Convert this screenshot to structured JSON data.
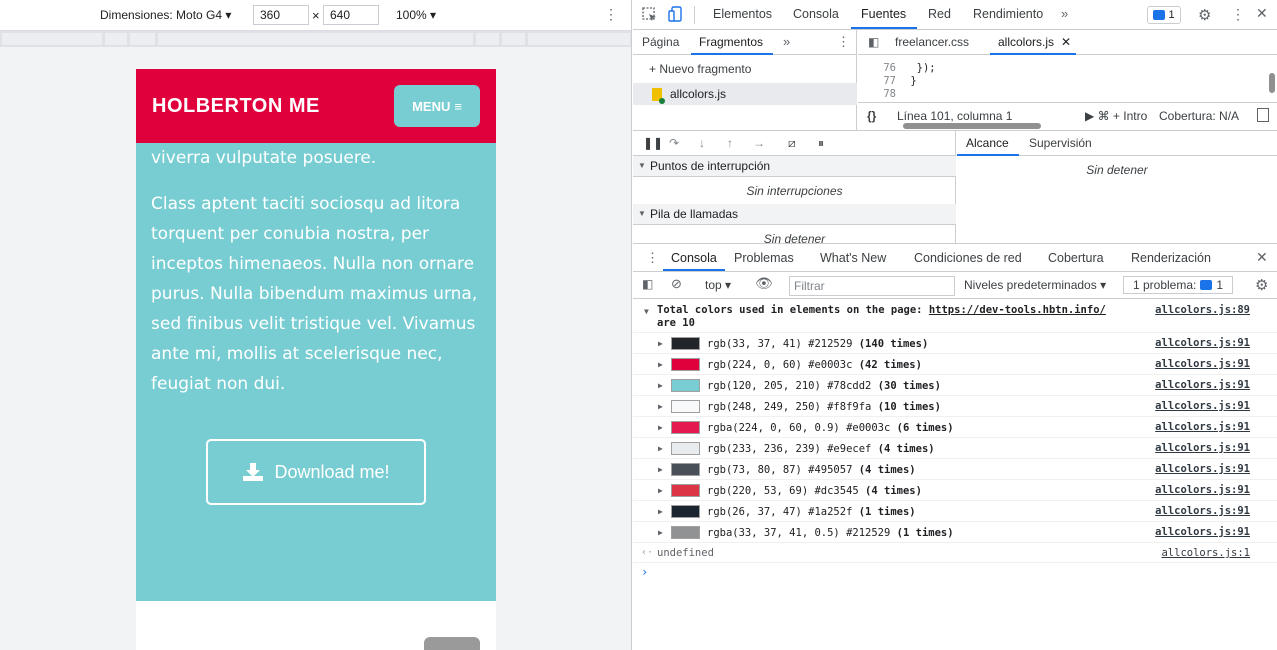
{
  "device_toolbar": {
    "dimensions_label": "Dimensiones: Moto G4",
    "width": "360",
    "times": "×",
    "height": "640",
    "zoom": "100%"
  },
  "site": {
    "brand": "HOLBERTON ME",
    "menu_label": "MENU",
    "para1": "viverra vulputate posuere.",
    "para2": "Class aptent taciti sociosqu ad litora torquent per conubia nostra, per inceptos himenaeos. Nulla non ornare purus. Nulla bibendum maximus urna, sed finibus velit tristique vel. Vivamus ante mi, mollis at scelerisque nec, feugiat non dui.",
    "download_label": "Download me!",
    "colors": {
      "brand_red": "#e0003c",
      "teal": "#78cdd2"
    }
  },
  "devtools": {
    "tabs": [
      "Elementos",
      "Consola",
      "Fuentes",
      "Red",
      "Rendimiento"
    ],
    "active_tab": "Fuentes",
    "issues_count": "1",
    "nav_tabs": [
      "Página",
      "Fragmentos"
    ],
    "new_snippet": "+ Nuevo fragmento",
    "snippet_file": "allcolors.js",
    "editor_tabs": [
      "freelancer.css",
      "allcolors.js"
    ],
    "code_lines": [
      {
        "num": "76",
        "text": "  });"
      },
      {
        "num": "77",
        "text": " }"
      },
      {
        "num": "78",
        "text": ""
      }
    ],
    "status": {
      "braces": "{}",
      "position": "Línea 101, columna 1",
      "run": "⌘ + Intro",
      "coverage": "Cobertura: N/A"
    },
    "debugger": {
      "breakpoints_title": "Puntos de interrupción",
      "breakpoints_empty": "Sin interrupciones",
      "callstack_title": "Pila de llamadas",
      "callstack_empty": "Sin detener",
      "scope_tab": "Alcance",
      "watch_tab": "Supervisión",
      "scope_empty": "Sin detener"
    },
    "drawer_tabs": [
      "Consola",
      "Problemas",
      "What's New",
      "Condiciones de red",
      "Cobertura",
      "Renderización"
    ],
    "console_toolbar": {
      "context": "top",
      "filter_placeholder": "Filtrar",
      "levels": "Niveles predeterminados",
      "problems": "1 problema:",
      "problems_count": "1"
    },
    "console": {
      "header_text": "Total colors used in elements on the page:",
      "header_link": "https://dev-tools.hbtn.info/",
      "header_text2": "are 10",
      "header_src": "allcolors.js:89",
      "rows": [
        {
          "color": "#212529",
          "label": "rgb(33, 37, 41) #212529",
          "times": "(140 times)",
          "src": "allcolors.js:91"
        },
        {
          "color": "#e0003c",
          "label": "rgb(224, 0, 60) #e0003c",
          "times": "(42 times)",
          "src": "allcolors.js:91"
        },
        {
          "color": "#78cdd2",
          "label": "rgb(120, 205, 210) #78cdd2",
          "times": "(30 times)",
          "src": "allcolors.js:91"
        },
        {
          "color": "#f8f9fa",
          "label": "rgb(248, 249, 250) #f8f9fa",
          "times": "(10 times)",
          "src": "allcolors.js:91"
        },
        {
          "color": "rgba(224,0,60,0.9)",
          "label": "rgba(224, 0, 60, 0.9) #e0003c",
          "times": "(6 times)",
          "src": "allcolors.js:91"
        },
        {
          "color": "#e9ecef",
          "label": "rgb(233, 236, 239) #e9ecef",
          "times": "(4 times)",
          "src": "allcolors.js:91"
        },
        {
          "color": "#495057",
          "label": "rgb(73, 80, 87) #495057",
          "times": "(4 times)",
          "src": "allcolors.js:91"
        },
        {
          "color": "#dc3545",
          "label": "rgb(220, 53, 69) #dc3545",
          "times": "(4 times)",
          "src": "allcolors.js:91"
        },
        {
          "color": "#1a252f",
          "label": "rgb(26, 37, 47) #1a252f",
          "times": "(1 times)",
          "src": "allcolors.js:91"
        },
        {
          "color": "rgba(33,37,41,0.5)",
          "label": "rgba(33, 37, 41, 0.5) #212529",
          "times": "(1 times)",
          "src": "allcolors.js:91"
        }
      ],
      "result": "undefined",
      "result_src": "allcolors.js:1"
    }
  }
}
